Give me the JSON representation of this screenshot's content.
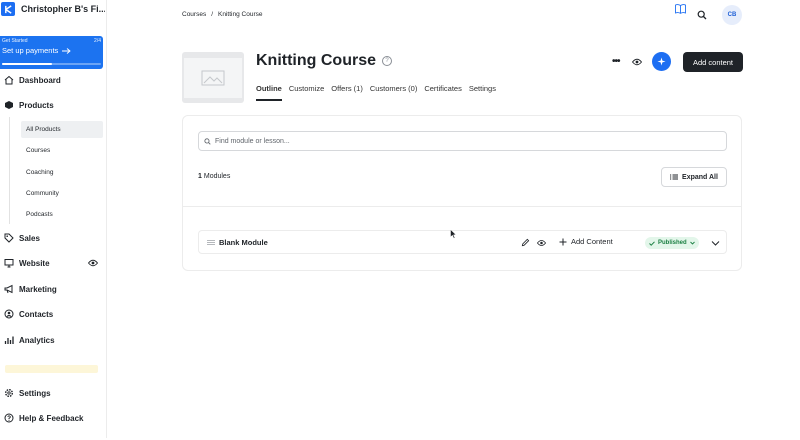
{
  "brand": {
    "name": "Christopher B's Fi..."
  },
  "setup": {
    "kicker": "Get Started",
    "progress_text": "2/4",
    "title": "Set up payments",
    "progress": 0.5
  },
  "nav": {
    "dashboard": "Dashboard",
    "products": "Products",
    "sub": [
      "All Products",
      "Courses",
      "Coaching",
      "Community",
      "Podcasts"
    ],
    "sales": "Sales",
    "website": "Website",
    "marketing": "Marketing",
    "contacts": "Contacts",
    "analytics": "Analytics",
    "settings": "Settings",
    "help": "Help & Feedback"
  },
  "breadcrumb": {
    "parent": "Courses",
    "sep": "/",
    "current": "Knitting Course"
  },
  "user": {
    "initials": "CB"
  },
  "course": {
    "title": "Knitting Course",
    "help": "?"
  },
  "tabs": [
    "Outline",
    "Customize",
    "Offers (1)",
    "Customers (0)",
    "Certificates",
    "Settings"
  ],
  "actions": {
    "more": "•••",
    "add_content": "Add content"
  },
  "outline": {
    "search_placeholder": "Find module or lesson...",
    "module_count": "1",
    "module_count_label": "Modules",
    "expand_all": "Expand All",
    "module": {
      "name": "Blank Module",
      "add_content": "Add Content",
      "status": "Published"
    }
  },
  "colors": {
    "accent": "#1d6ef2",
    "published_bg": "#e3f6ea",
    "published_fg": "#1a7f42"
  }
}
